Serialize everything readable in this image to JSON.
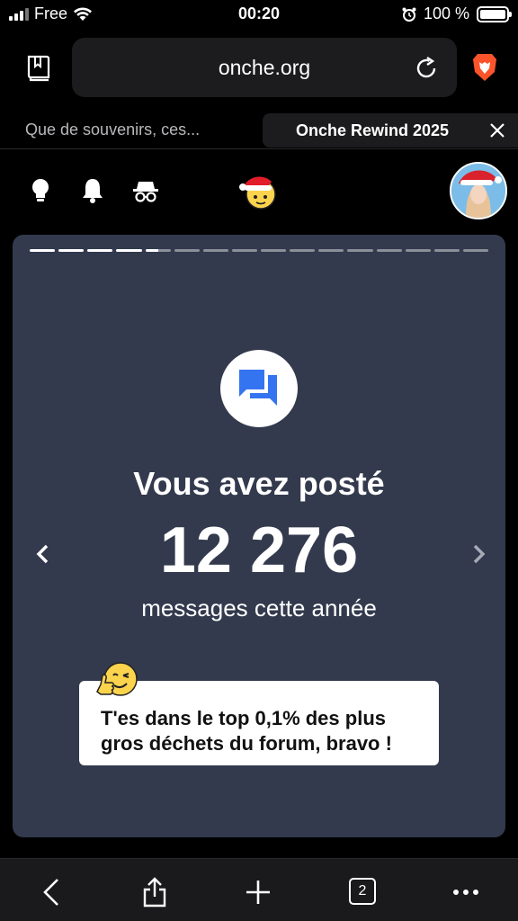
{
  "status_bar": {
    "carrier": "Free",
    "time": "00:20",
    "battery": "100 %"
  },
  "browser": {
    "url": "onche.org"
  },
  "tabs": [
    {
      "label": "Que de souvenirs, ces...",
      "active": false
    },
    {
      "label": "Onche Rewind 2025",
      "active": true
    }
  ],
  "card": {
    "progress": {
      "segments": 16,
      "completed": 4.5
    },
    "headline": "Vous avez posté",
    "count": "12 276",
    "subline": "messages cette année",
    "fact": "T'es dans le top 0,1% des plus gros déchets du forum, bravo !"
  },
  "toolbar": {
    "tab_count": "2"
  },
  "colors": {
    "background": "#000000",
    "card": "#333a4d",
    "accent_blue": "#3574f0",
    "brave_orange": "#fb542b"
  },
  "icons": [
    "bookmarks-icon",
    "reload-icon",
    "brave-lion-icon",
    "close-icon",
    "lightbulb-icon",
    "bell-icon",
    "incognito-icon",
    "santa-emoji-icon",
    "chat-icon",
    "chevron-left-icon",
    "chevron-right-icon",
    "wink-thumbs-up-emoji-icon",
    "back-icon",
    "share-icon",
    "plus-icon",
    "more-icon"
  ]
}
